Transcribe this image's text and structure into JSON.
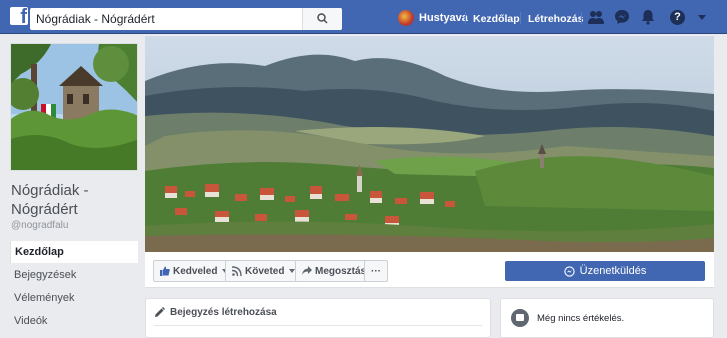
{
  "topbar": {
    "search_value": "Nógrádiak - Nógrádért",
    "user_name": "Hustyava",
    "home_label": "Kezdőlap",
    "create_label": "Létrehozás",
    "icons": [
      "friends-icon",
      "messenger-icon",
      "notifications-icon",
      "help-icon",
      "account-menu-icon"
    ],
    "bar_color": "#4267b2"
  },
  "page": {
    "name": "Nógrádiak - Nógrádért",
    "handle": "@nogradfalu"
  },
  "left_nav": {
    "items": [
      {
        "label": "Kezdőlap",
        "active": true
      },
      {
        "label": "Bejegyzések"
      },
      {
        "label": "Vélemények"
      },
      {
        "label": "Videók"
      }
    ]
  },
  "actions": {
    "like_label": "Kedveled",
    "follow_label": "Követed",
    "share_label": "Megosztás",
    "more_label": "···",
    "message_label": "Üzenetküldés"
  },
  "create_post": {
    "title": "Bejegyzés létrehozása"
  },
  "reviews": {
    "text": "Még nincs értékelés."
  }
}
